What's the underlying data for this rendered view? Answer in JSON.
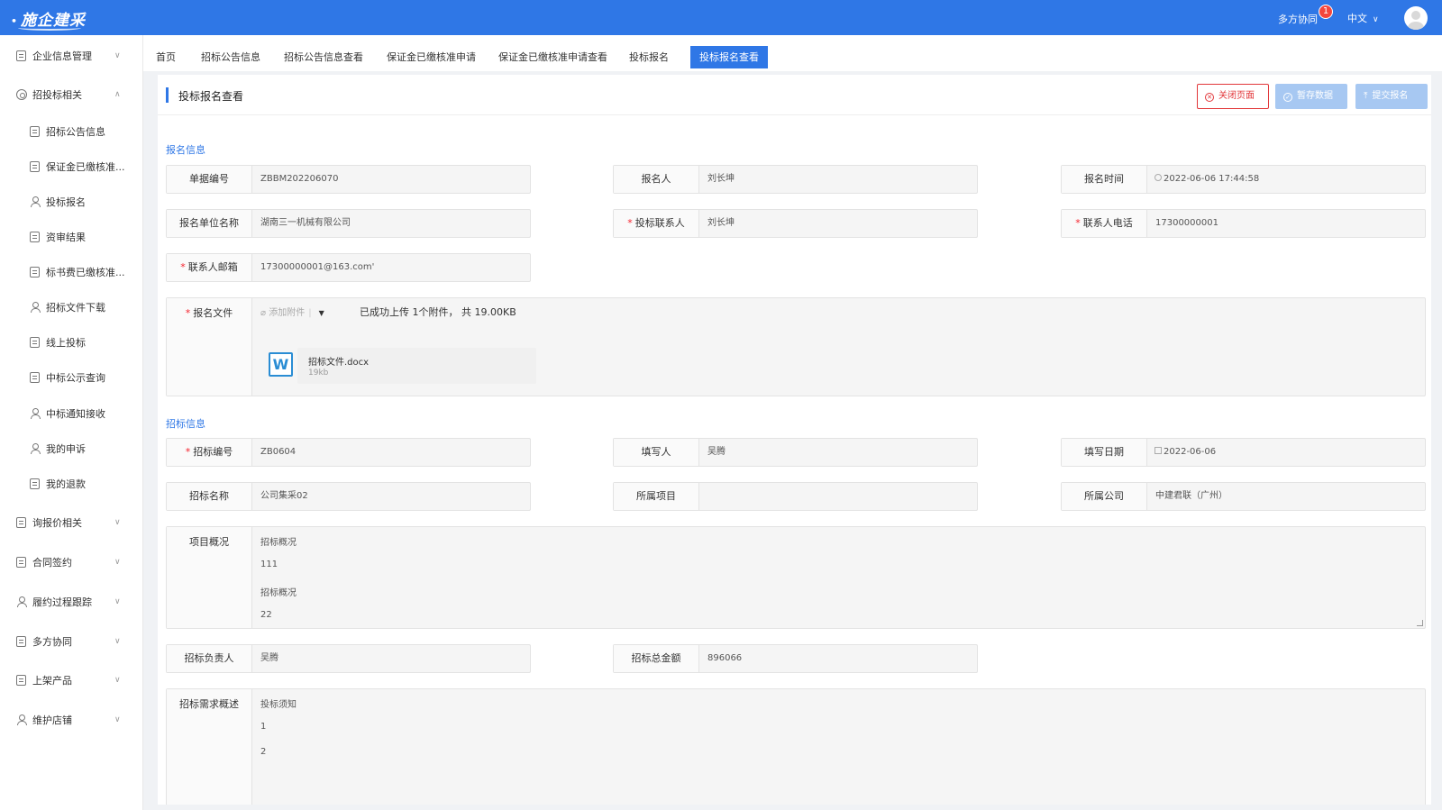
{
  "app": {
    "logo": "施企建采"
  },
  "header": {
    "collab_label": "多方协同",
    "badge_count": "1",
    "language": "中文"
  },
  "sidebar": {
    "groups": [
      {
        "label": "企业信息管理",
        "icon": "document-icon",
        "expanded": false
      },
      {
        "label": "招投标相关",
        "icon": "target-icon",
        "expanded": true
      },
      {
        "label": "询报价相关",
        "icon": "quote-icon",
        "expanded": false
      },
      {
        "label": "合同签约",
        "icon": "contract-icon",
        "expanded": false
      },
      {
        "label": "履约过程跟踪",
        "icon": "track-icon",
        "expanded": false
      },
      {
        "label": "多方协同",
        "icon": "collab-icon",
        "expanded": false
      },
      {
        "label": "上架产品",
        "icon": "product-icon",
        "expanded": false
      },
      {
        "label": "维护店铺",
        "icon": "shop-icon",
        "expanded": false
      }
    ],
    "sub_items": [
      {
        "label": "招标公告信息"
      },
      {
        "label": "保证金已缴核准..."
      },
      {
        "label": "投标报名"
      },
      {
        "label": "资审结果"
      },
      {
        "label": "标书费已缴核准..."
      },
      {
        "label": "招标文件下载"
      },
      {
        "label": "线上投标"
      },
      {
        "label": "中标公示查询"
      },
      {
        "label": "中标通知接收"
      },
      {
        "label": "我的申诉"
      },
      {
        "label": "我的退款"
      }
    ]
  },
  "tabs": [
    {
      "label": "首页"
    },
    {
      "label": "招标公告信息"
    },
    {
      "label": "招标公告信息查看"
    },
    {
      "label": "保证金已缴核准申请"
    },
    {
      "label": "保证金已缴核准申请查看"
    },
    {
      "label": "投标报名"
    },
    {
      "label": "投标报名查看",
      "active": true
    }
  ],
  "page": {
    "title": "投标报名查看",
    "buttons": {
      "close": "关闭页面",
      "save": "暂存数据",
      "submit": "提交报名"
    }
  },
  "registration": {
    "section_title": "报名信息",
    "doc_no": {
      "label": "单据编号",
      "value": "ZBBM202206070"
    },
    "registrant": {
      "label": "报名人",
      "value": "刘长坤"
    },
    "reg_time": {
      "label": "报名时间",
      "value": "2022-06-06 17:44:58"
    },
    "company": {
      "label": "报名单位名称",
      "value": "湖南三一机械有限公司"
    },
    "contact": {
      "label": "投标联系人",
      "value": "刘长坤"
    },
    "phone": {
      "label": "联系人电话",
      "value": "17300000001"
    },
    "email": {
      "label": "联系人邮箱",
      "value": "17300000001@163.com'"
    },
    "files": {
      "label": "报名文件",
      "add_label": "添加附件",
      "upload_msg": "已成功上传 1个附件， 共 19.00KB",
      "file_name": "招标文件.docx",
      "file_size": "19kb"
    }
  },
  "tender": {
    "section_title": "招标信息",
    "tender_no": {
      "label": "招标编号",
      "value": "ZB0604"
    },
    "filler": {
      "label": "填写人",
      "value": "吴腾"
    },
    "fill_date": {
      "label": "填写日期",
      "value": "2022-06-06"
    },
    "tender_name": {
      "label": "招标名称",
      "value": "公司集采02"
    },
    "project": {
      "label": "所属项目",
      "value": ""
    },
    "company": {
      "label": "所属公司",
      "value": "中建君联（广州）"
    },
    "overview": {
      "label": "项目概况",
      "lines": [
        "招标概况",
        "111",
        "招标概况",
        "22"
      ]
    },
    "owner": {
      "label": "招标负责人",
      "value": "吴腾"
    },
    "amount": {
      "label": "招标总金额",
      "value": "896066"
    },
    "requirements": {
      "label": "招标需求概述",
      "lines": [
        "投标须知",
        "1",
        "2"
      ]
    }
  },
  "colors": {
    "primary": "#2f77e6",
    "danger": "#e2373a",
    "disabled": "#a7c8f2"
  }
}
